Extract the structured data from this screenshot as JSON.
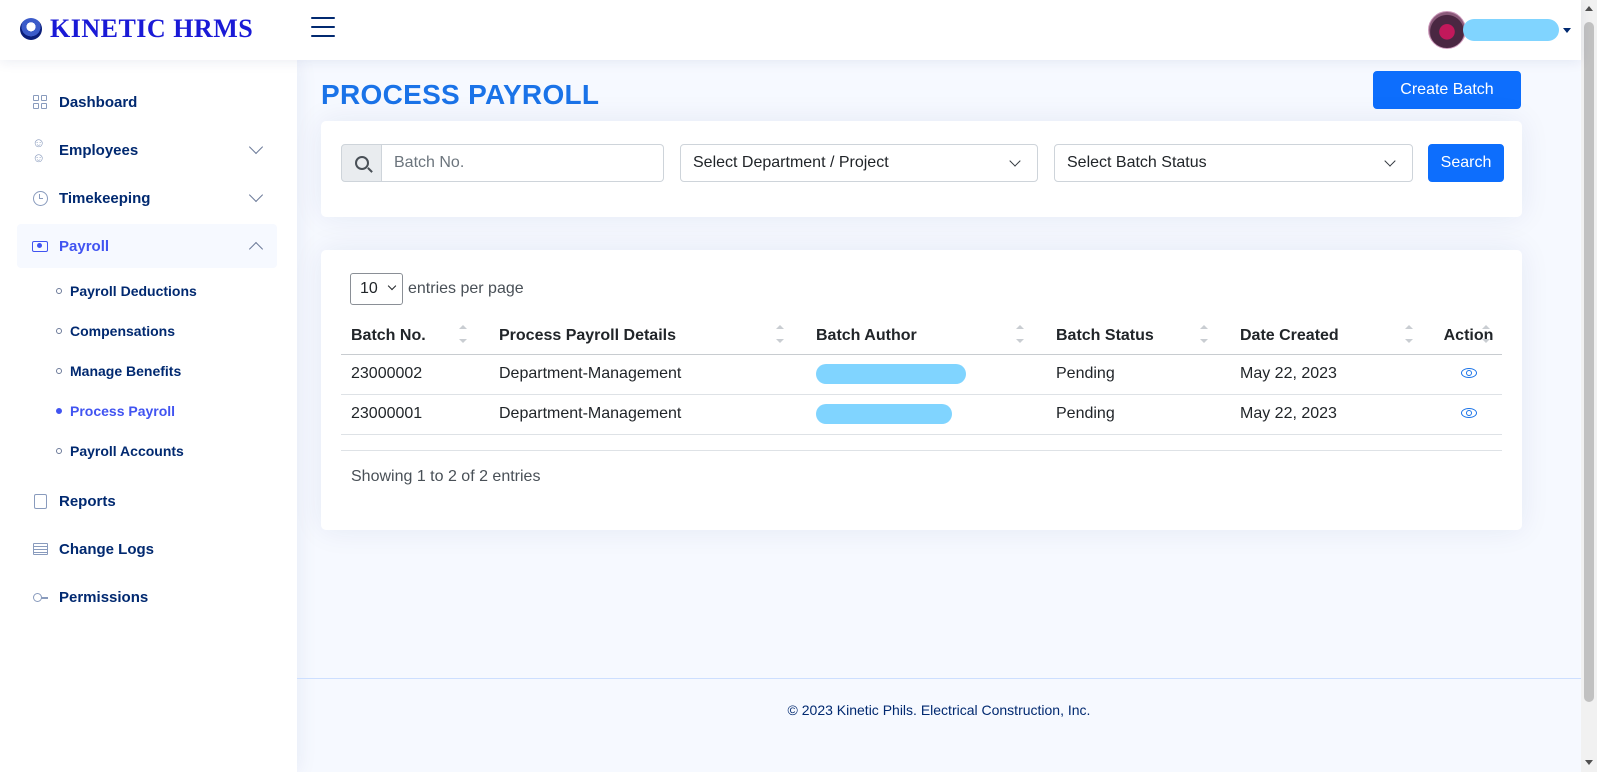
{
  "app": {
    "name": "KINETIC HRMS"
  },
  "header": {
    "menu_icon": "hamburger-icon",
    "profile_icon": "avatar"
  },
  "sidebar": {
    "items": [
      {
        "label": "Dashboard",
        "icon": "grid-icon"
      },
      {
        "label": "Employees",
        "icon": "people-icon"
      },
      {
        "label": "Timekeeping",
        "icon": "clock-icon"
      },
      {
        "label": "Payroll",
        "icon": "cash-icon"
      },
      {
        "label": "Reports",
        "icon": "clipboard-icon"
      },
      {
        "label": "Change Logs",
        "icon": "list-icon"
      },
      {
        "label": "Permissions",
        "icon": "key-icon"
      }
    ],
    "payroll_sub": [
      {
        "label": "Payroll Deductions"
      },
      {
        "label": "Compensations"
      },
      {
        "label": "Manage Benefits"
      },
      {
        "label": "Process Payroll"
      },
      {
        "label": "Payroll Accounts"
      }
    ]
  },
  "page": {
    "title": "PROCESS PAYROLL",
    "create_button": "Create Batch"
  },
  "filters": {
    "batch_placeholder": "Batch No.",
    "department_select": "Select Department / Project",
    "status_select": "Select Batch Status",
    "search_button": "Search"
  },
  "table": {
    "per_page_value": "10",
    "per_page_label": "entries per page",
    "columns": [
      "Batch No.",
      "Process Payroll Details",
      "Batch Author",
      "Batch Status",
      "Date Created",
      "Action"
    ],
    "rows": [
      {
        "batch_no": "23000002",
        "details": "Department-Management",
        "status": "Pending",
        "date": "May 22, 2023"
      },
      {
        "batch_no": "23000001",
        "details": "Department-Management",
        "status": "Pending",
        "date": "May 22, 2023"
      }
    ],
    "info": "Showing 1 to 2 of 2 entries"
  },
  "footer": {
    "text": "© 2023 Kinetic Phils. Electrical Construction, Inc."
  },
  "colors": {
    "accent": "#0d6efd",
    "title": "#1a73e8",
    "nav": "#012970",
    "active": "#4154f1"
  }
}
